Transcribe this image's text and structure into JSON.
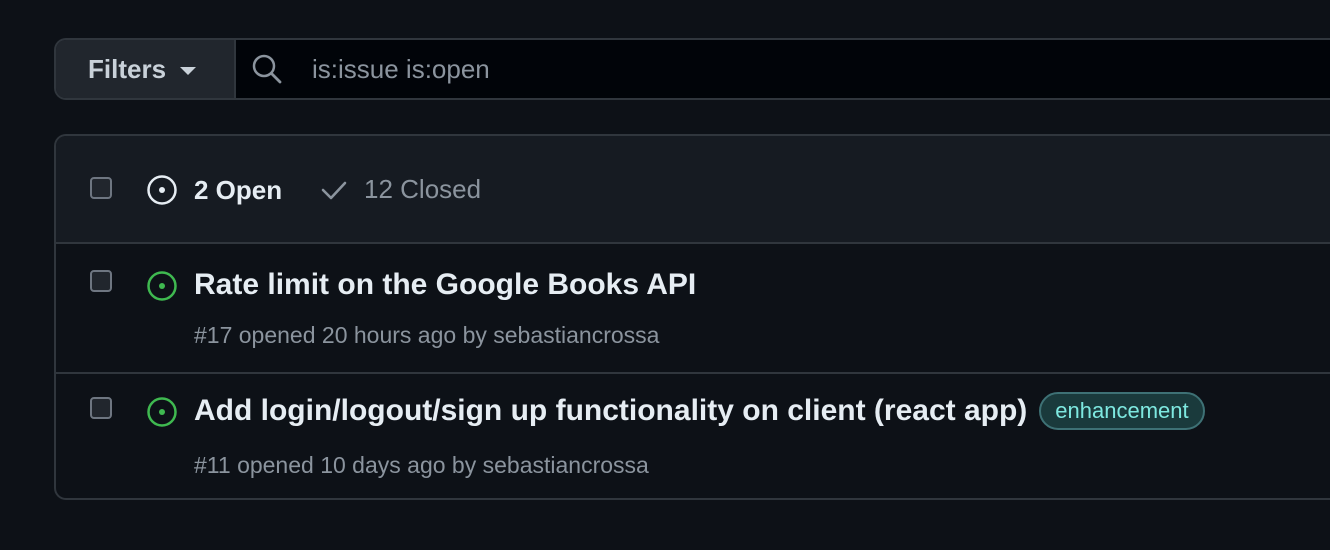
{
  "filters": {
    "button_label": "Filters",
    "search_value": "is:issue is:open"
  },
  "issues_header": {
    "open_label": "2 Open",
    "closed_label": "12 Closed"
  },
  "issues": [
    {
      "title": "Rate limit on the Google Books API",
      "number": "#17",
      "meta_text": "opened 20 hours ago by",
      "author": "sebastiancrossa",
      "label": null
    },
    {
      "title": "Add login/logout/sign up functionality on client (react app)",
      "number": "#11",
      "meta_text": "opened 10 days ago by",
      "author": "sebastiancrossa",
      "label": "enhancement"
    }
  ],
  "colors": {
    "open_icon": "#3fb950",
    "background": "#0d1117",
    "label_text": "#7ee8e0"
  }
}
